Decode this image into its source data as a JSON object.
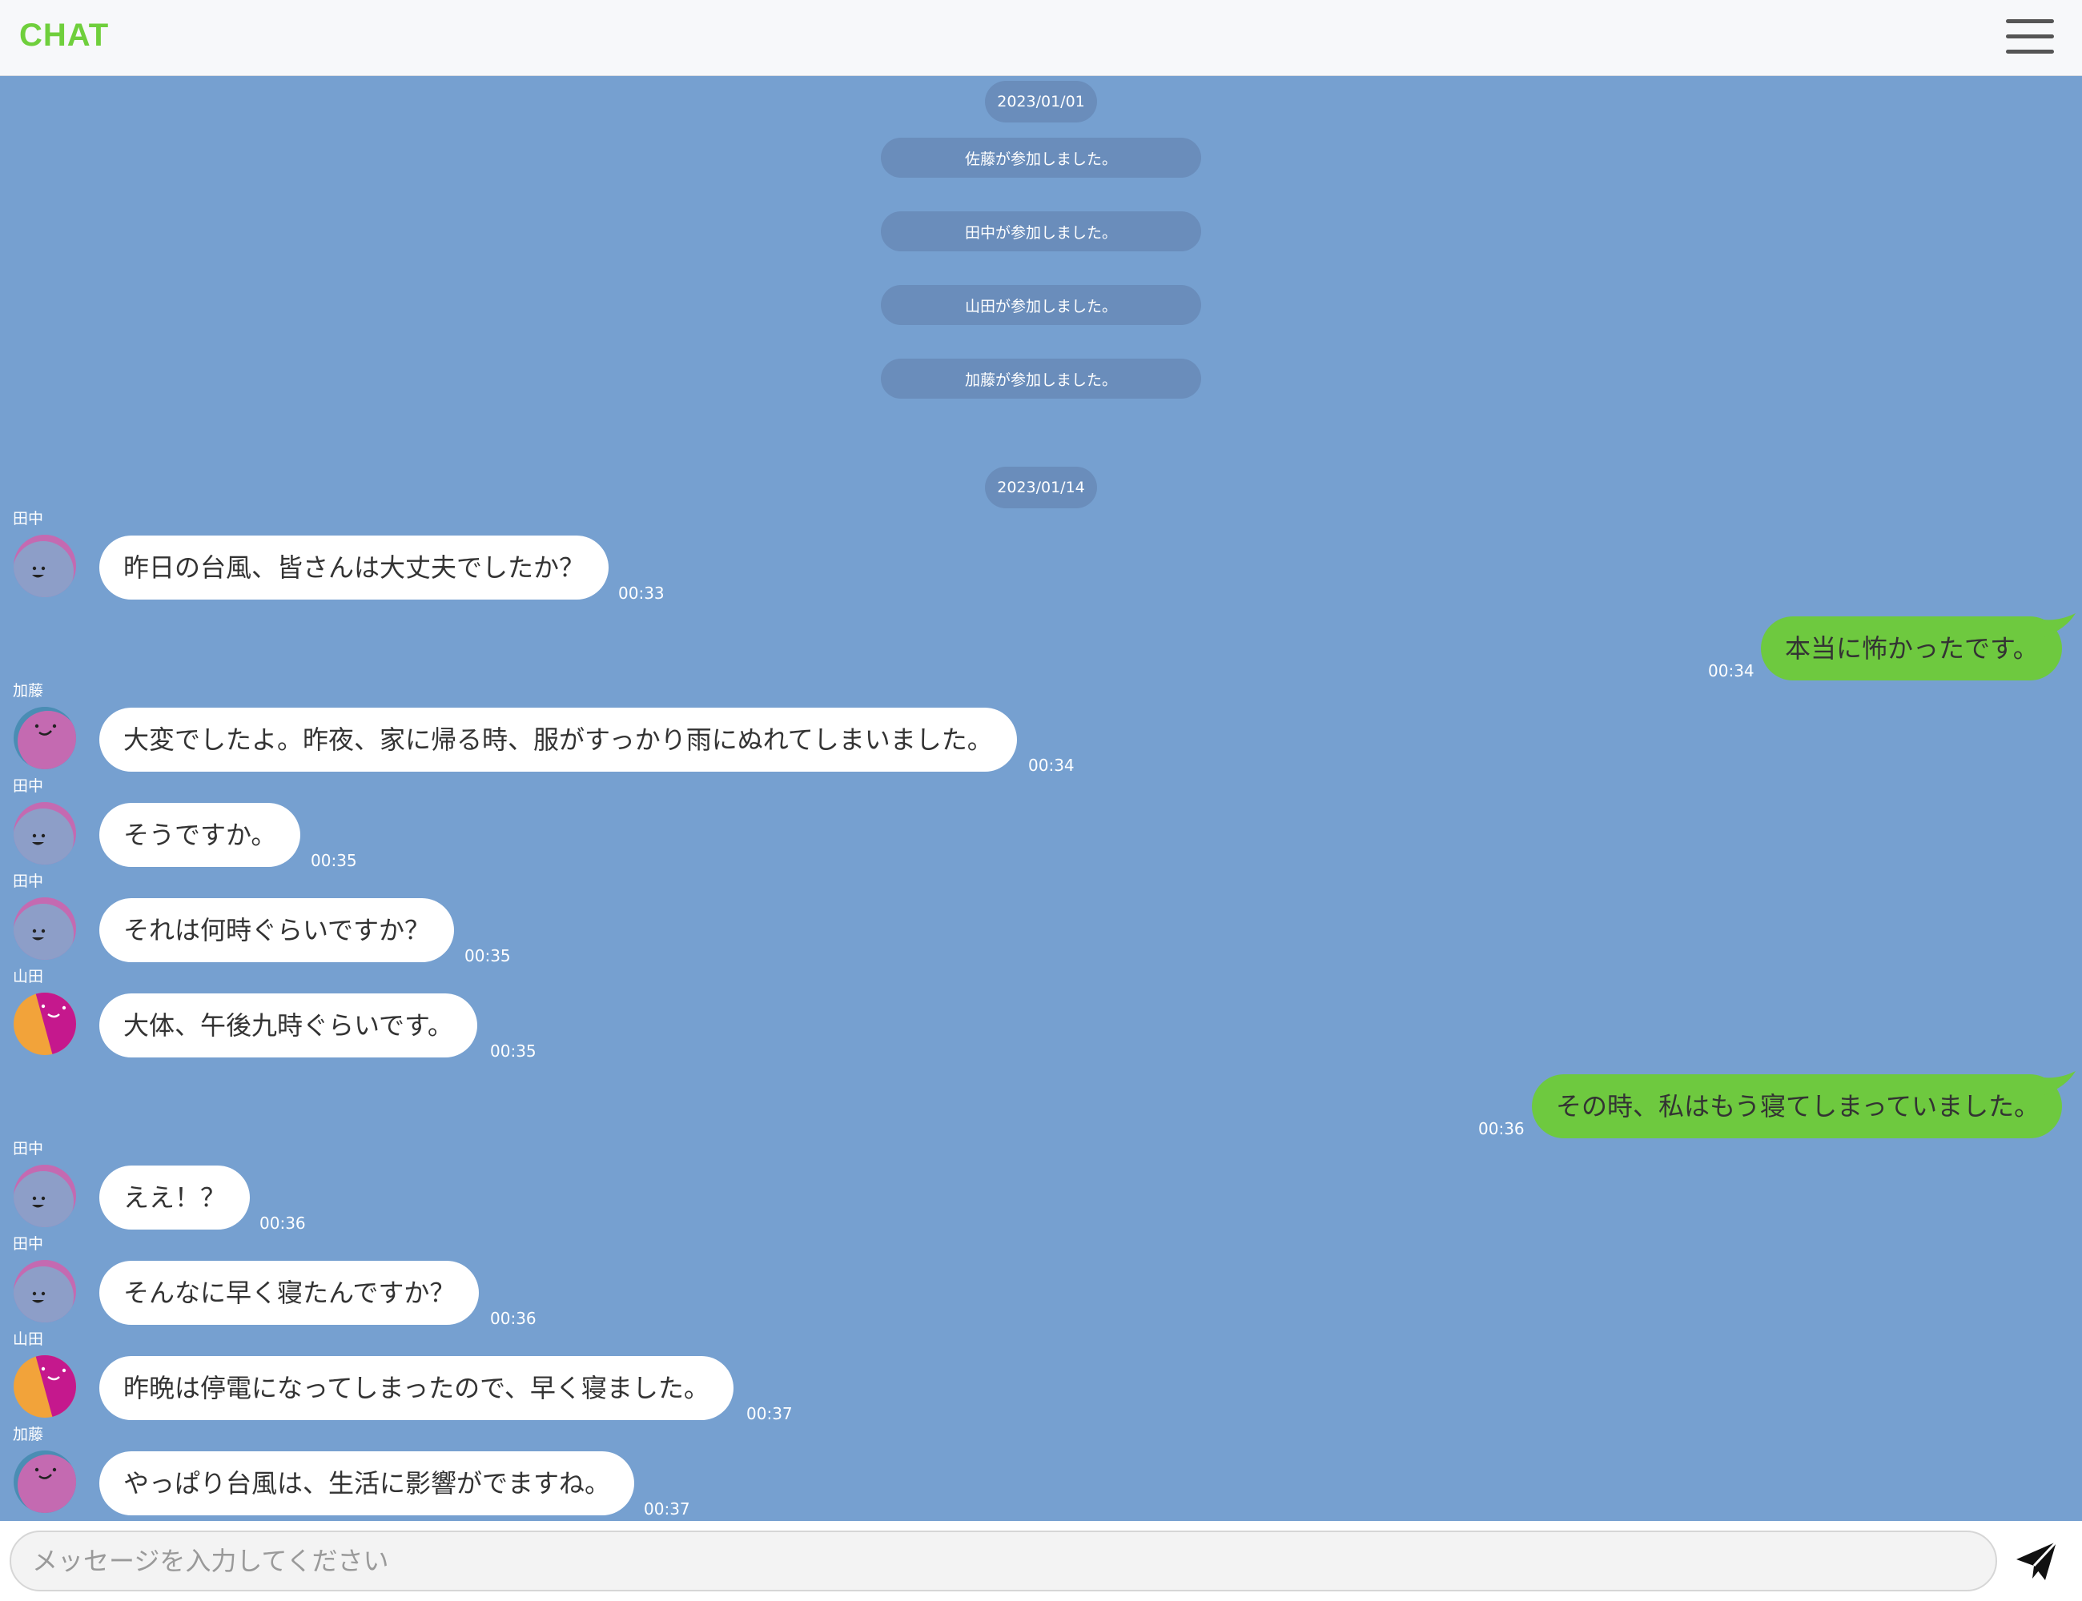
{
  "header": {
    "brand": "CHAT",
    "menu_icon": "hamburger-menu-icon"
  },
  "dates": {
    "first": "2023/01/01",
    "second": "2023/01/14"
  },
  "system_messages": [
    "佐藤が参加しました。",
    "田中が参加しました。",
    "山田が参加しました。",
    "加藤が参加しました。"
  ],
  "messages": [
    {
      "sender": "田中",
      "text": "昨日の台風、皆さんは大丈夫でしたか？",
      "time": "00:33"
    },
    {
      "text": "本当に怖かったです。",
      "time": "00:34"
    },
    {
      "sender": "加藤",
      "text": "大変でしたよ。昨夜、家に帰る時、服がすっかり雨にぬれてしまいました。",
      "time": "00:34"
    },
    {
      "sender": "田中",
      "text": "そうですか。",
      "time": "00:35"
    },
    {
      "sender": "田中",
      "text": "それは何時ぐらいですか？",
      "time": "00:35"
    },
    {
      "sender": "山田",
      "text": "大体、午後九時ぐらいです。",
      "time": "00:35"
    },
    {
      "text": "その時、私はもう寝てしまっていました。",
      "time": "00:36"
    },
    {
      "sender": "田中",
      "text": "ええ！？",
      "time": "00:36"
    },
    {
      "sender": "田中",
      "text": "そんなに早く寝たんですか？",
      "time": "00:36"
    },
    {
      "sender": "山田",
      "text": "昨晩は停電になってしまったので、早く寝ました。",
      "time": "00:37"
    },
    {
      "sender": "加藤",
      "text": "やっぱり台風は、生活に影響がでますね。",
      "time": "00:37"
    }
  ],
  "composer": {
    "placeholder": "メッセージを入力してください",
    "value": "",
    "send_icon": "paper-plane-send-icon"
  },
  "colors": {
    "chat_background": "#76a0d0",
    "brand": "#6fcf3c",
    "outgoing_bubble": "#6ec93f",
    "incoming_bubble": "#ffffff",
    "pill": "#6a8dbb"
  }
}
